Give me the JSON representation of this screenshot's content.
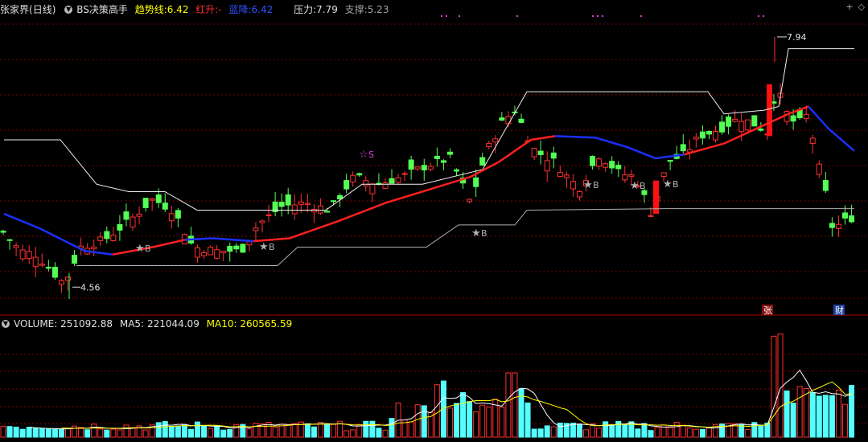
{
  "header": {
    "stock": "张家界",
    "period": "(日线)",
    "indicator": "BS决策高手",
    "trend_label": "趋势线:",
    "trend_value": "6.42",
    "red_label": "红升:",
    "red_value": "-",
    "blue_label": "蓝降:",
    "blue_value": "6.42",
    "pressure_label": "压力:",
    "pressure_value": "7.79",
    "support_label": "支撑:",
    "support_value": "5.23",
    "icons": [
      "plus-icon",
      "diamond-icon"
    ]
  },
  "volume_header": {
    "volume_label": "VOLUME:",
    "volume_value": "251092.88",
    "ma5_label": "MA5:",
    "ma5_value": "221044.09",
    "ma10_label": "MA10:",
    "ma10_value": "260565.59"
  },
  "annotations": {
    "high": "7.94",
    "low": "4.56",
    "buy": "B",
    "sell": "S",
    "badge_zhang": "张",
    "badge_cai": "财"
  },
  "colors": {
    "background": "#000000",
    "up": "#ff3030",
    "down": "#54ff54",
    "trend_up": "#ff2020",
    "trend_down": "#1a30ff",
    "volume_up": "#ff3030",
    "volume_down": "#54ffff",
    "grid": "#800000",
    "ma5": "#ffffff",
    "ma10": "#ffff00"
  },
  "chart_data": {
    "type": "candlestick",
    "price_range": [
      4.4,
      8.2
    ],
    "marked_high": 7.94,
    "marked_low": 4.56,
    "pressure": 7.79,
    "support": 5.23,
    "buy_signal_count": 6,
    "sell_signal_count": 1
  }
}
